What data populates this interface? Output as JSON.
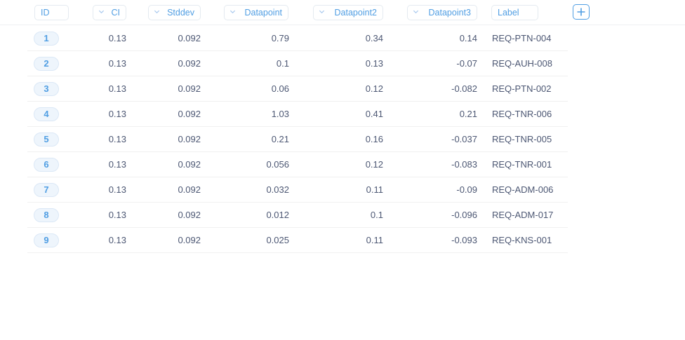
{
  "columns": {
    "id": "ID",
    "ci": "CI",
    "stddev": "Stddev",
    "datapoint": "Datapoint",
    "datapoint2": "Datapoint2",
    "datapoint3": "Datapoint3",
    "label": "Label"
  },
  "icons": {
    "add": "plus-icon",
    "sort": "chevron-down-icon"
  },
  "colors": {
    "accent": "#509ee3",
    "text": "#4c5773",
    "pill_bg": "#eef5fc"
  },
  "rows": [
    {
      "id": "1",
      "ci": "0.13",
      "stddev": "0.092",
      "datapoint": "0.79",
      "datapoint2": "0.34",
      "datapoint3": "0.14",
      "label": "REQ-PTN-004"
    },
    {
      "id": "2",
      "ci": "0.13",
      "stddev": "0.092",
      "datapoint": "0.1",
      "datapoint2": "0.13",
      "datapoint3": "-0.07",
      "label": "REQ-AUH-008"
    },
    {
      "id": "3",
      "ci": "0.13",
      "stddev": "0.092",
      "datapoint": "0.06",
      "datapoint2": "0.12",
      "datapoint3": "-0.082",
      "label": "REQ-PTN-002"
    },
    {
      "id": "4",
      "ci": "0.13",
      "stddev": "0.092",
      "datapoint": "1.03",
      "datapoint2": "0.41",
      "datapoint3": "0.21",
      "label": "REQ-TNR-006"
    },
    {
      "id": "5",
      "ci": "0.13",
      "stddev": "0.092",
      "datapoint": "0.21",
      "datapoint2": "0.16",
      "datapoint3": "-0.037",
      "label": "REQ-TNR-005"
    },
    {
      "id": "6",
      "ci": "0.13",
      "stddev": "0.092",
      "datapoint": "0.056",
      "datapoint2": "0.12",
      "datapoint3": "-0.083",
      "label": "REQ-TNR-001"
    },
    {
      "id": "7",
      "ci": "0.13",
      "stddev": "0.092",
      "datapoint": "0.032",
      "datapoint2": "0.11",
      "datapoint3": "-0.09",
      "label": "REQ-ADM-006"
    },
    {
      "id": "8",
      "ci": "0.13",
      "stddev": "0.092",
      "datapoint": "0.012",
      "datapoint2": "0.1",
      "datapoint3": "-0.096",
      "label": "REQ-ADM-017"
    },
    {
      "id": "9",
      "ci": "0.13",
      "stddev": "0.092",
      "datapoint": "0.025",
      "datapoint2": "0.11",
      "datapoint3": "-0.093",
      "label": "REQ-KNS-001"
    }
  ]
}
